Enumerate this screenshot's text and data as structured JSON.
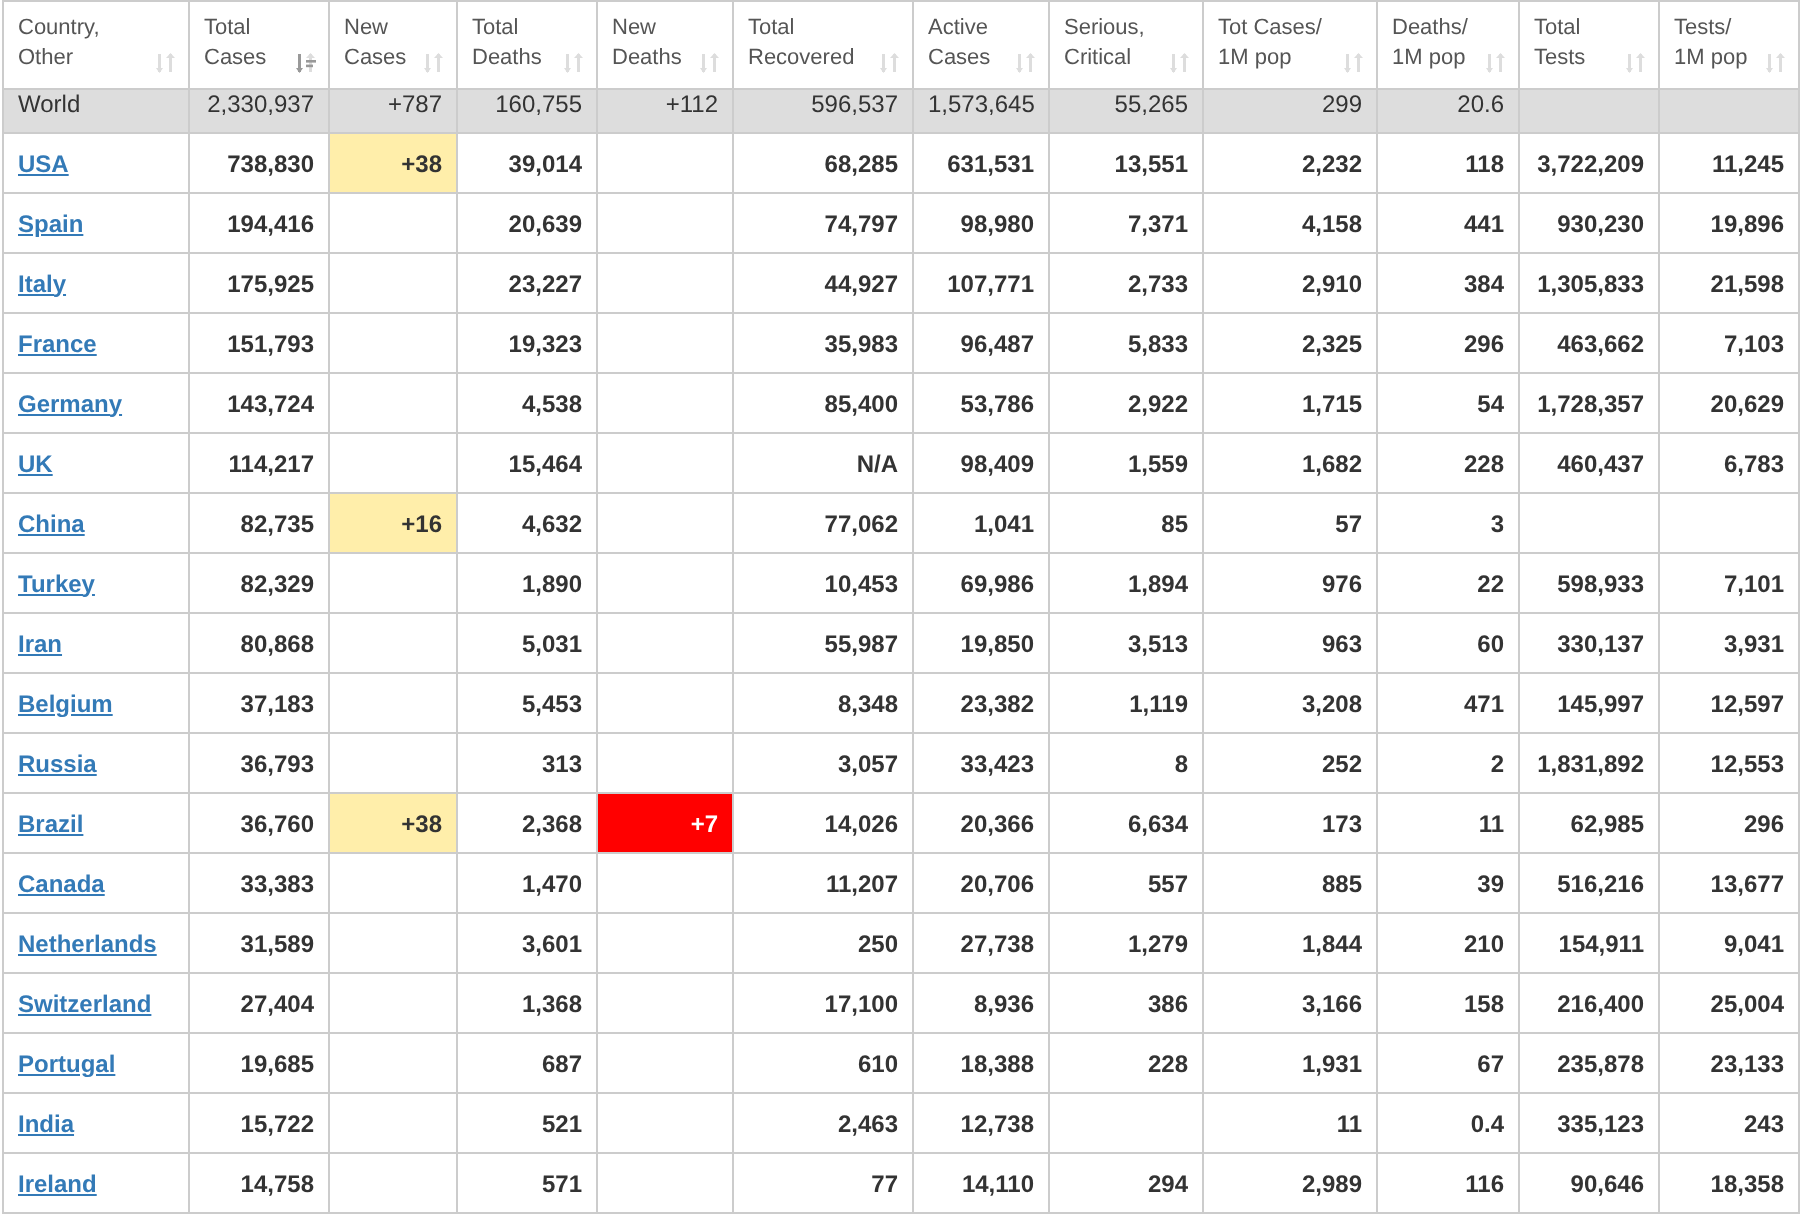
{
  "columns": [
    {
      "label": "Country, Other",
      "sorted": false
    },
    {
      "label": "Total Cases",
      "sorted": true
    },
    {
      "label": "New Cases",
      "sorted": false
    },
    {
      "label": "Total Deaths",
      "sorted": false
    },
    {
      "label": "New Deaths",
      "sorted": false
    },
    {
      "label": "Total Recovered",
      "sorted": false
    },
    {
      "label": "Active Cases",
      "sorted": false
    },
    {
      "label": "Serious, Critical",
      "sorted": false
    },
    {
      "label": "Tot Cases/ 1M pop",
      "sorted": false
    },
    {
      "label": "Deaths/ 1M pop",
      "sorted": false
    },
    {
      "label": "Total Tests",
      "sorted": false
    },
    {
      "label": "Tests/ 1M pop",
      "sorted": false
    }
  ],
  "world": {
    "country": "World",
    "total_cases": "2,330,937",
    "new_cases": "+787",
    "total_deaths": "160,755",
    "new_deaths": "+112",
    "total_recovered": "596,537",
    "active_cases": "1,573,645",
    "serious_critical": "55,265",
    "cases_per_1m": "299",
    "deaths_per_1m": "20.6"
  },
  "rows": [
    {
      "country": "USA",
      "total_cases": "738,830",
      "new_cases": "+38",
      "total_deaths": "39,014",
      "total_recovered": "68,285",
      "active_cases": "631,531",
      "serious_critical": "13,551",
      "cases_per_1m": "2,232",
      "deaths_per_1m": "118",
      "total_tests": "3,722,209",
      "tests_per_1m": "11,245"
    },
    {
      "country": "Spain",
      "total_cases": "194,416",
      "total_deaths": "20,639",
      "total_recovered": "74,797",
      "active_cases": "98,980",
      "serious_critical": "7,371",
      "cases_per_1m": "4,158",
      "deaths_per_1m": "441",
      "total_tests": "930,230",
      "tests_per_1m": "19,896"
    },
    {
      "country": "Italy",
      "total_cases": "175,925",
      "total_deaths": "23,227",
      "total_recovered": "44,927",
      "active_cases": "107,771",
      "serious_critical": "2,733",
      "cases_per_1m": "2,910",
      "deaths_per_1m": "384",
      "total_tests": "1,305,833",
      "tests_per_1m": "21,598"
    },
    {
      "country": "France",
      "total_cases": "151,793",
      "total_deaths": "19,323",
      "total_recovered": "35,983",
      "active_cases": "96,487",
      "serious_critical": "5,833",
      "cases_per_1m": "2,325",
      "deaths_per_1m": "296",
      "total_tests": "463,662",
      "tests_per_1m": "7,103"
    },
    {
      "country": "Germany",
      "total_cases": "143,724",
      "total_deaths": "4,538",
      "total_recovered": "85,400",
      "active_cases": "53,786",
      "serious_critical": "2,922",
      "cases_per_1m": "1,715",
      "deaths_per_1m": "54",
      "total_tests": "1,728,357",
      "tests_per_1m": "20,629"
    },
    {
      "country": "UK",
      "total_cases": "114,217",
      "total_deaths": "15,464",
      "total_recovered": "N/A",
      "active_cases": "98,409",
      "serious_critical": "1,559",
      "cases_per_1m": "1,682",
      "deaths_per_1m": "228",
      "total_tests": "460,437",
      "tests_per_1m": "6,783"
    },
    {
      "country": "China",
      "total_cases": "82,735",
      "new_cases": "+16",
      "total_deaths": "4,632",
      "total_recovered": "77,062",
      "active_cases": "1,041",
      "serious_critical": "85",
      "cases_per_1m": "57",
      "deaths_per_1m": "3"
    },
    {
      "country": "Turkey",
      "total_cases": "82,329",
      "total_deaths": "1,890",
      "total_recovered": "10,453",
      "active_cases": "69,986",
      "serious_critical": "1,894",
      "cases_per_1m": "976",
      "deaths_per_1m": "22",
      "total_tests": "598,933",
      "tests_per_1m": "7,101"
    },
    {
      "country": "Iran",
      "total_cases": "80,868",
      "total_deaths": "5,031",
      "total_recovered": "55,987",
      "active_cases": "19,850",
      "serious_critical": "3,513",
      "cases_per_1m": "963",
      "deaths_per_1m": "60",
      "total_tests": "330,137",
      "tests_per_1m": "3,931"
    },
    {
      "country": "Belgium",
      "total_cases": "37,183",
      "total_deaths": "5,453",
      "total_recovered": "8,348",
      "active_cases": "23,382",
      "serious_critical": "1,119",
      "cases_per_1m": "3,208",
      "deaths_per_1m": "471",
      "total_tests": "145,997",
      "tests_per_1m": "12,597"
    },
    {
      "country": "Russia",
      "total_cases": "36,793",
      "total_deaths": "313",
      "total_recovered": "3,057",
      "active_cases": "33,423",
      "serious_critical": "8",
      "cases_per_1m": "252",
      "deaths_per_1m": "2",
      "total_tests": "1,831,892",
      "tests_per_1m": "12,553"
    },
    {
      "country": "Brazil",
      "total_cases": "36,760",
      "new_cases": "+38",
      "total_deaths": "2,368",
      "new_deaths": "+7",
      "total_recovered": "14,026",
      "active_cases": "20,366",
      "serious_critical": "6,634",
      "cases_per_1m": "173",
      "deaths_per_1m": "11",
      "total_tests": "62,985",
      "tests_per_1m": "296"
    },
    {
      "country": "Canada",
      "total_cases": "33,383",
      "total_deaths": "1,470",
      "total_recovered": "11,207",
      "active_cases": "20,706",
      "serious_critical": "557",
      "cases_per_1m": "885",
      "deaths_per_1m": "39",
      "total_tests": "516,216",
      "tests_per_1m": "13,677"
    },
    {
      "country": "Netherlands",
      "total_cases": "31,589",
      "total_deaths": "3,601",
      "total_recovered": "250",
      "active_cases": "27,738",
      "serious_critical": "1,279",
      "cases_per_1m": "1,844",
      "deaths_per_1m": "210",
      "total_tests": "154,911",
      "tests_per_1m": "9,041"
    },
    {
      "country": "Switzerland",
      "total_cases": "27,404",
      "total_deaths": "1,368",
      "total_recovered": "17,100",
      "active_cases": "8,936",
      "serious_critical": "386",
      "cases_per_1m": "3,166",
      "deaths_per_1m": "158",
      "total_tests": "216,400",
      "tests_per_1m": "25,004"
    },
    {
      "country": "Portugal",
      "total_cases": "19,685",
      "total_deaths": "687",
      "total_recovered": "610",
      "active_cases": "18,388",
      "serious_critical": "228",
      "cases_per_1m": "1,931",
      "deaths_per_1m": "67",
      "total_tests": "235,878",
      "tests_per_1m": "23,133"
    },
    {
      "country": "India",
      "total_cases": "15,722",
      "total_deaths": "521",
      "total_recovered": "2,463",
      "active_cases": "12,738",
      "cases_per_1m": "11",
      "deaths_per_1m": "0.4",
      "total_tests": "335,123",
      "tests_per_1m": "243"
    },
    {
      "country": "Ireland",
      "total_cases": "14,758",
      "total_deaths": "571",
      "total_recovered": "77",
      "active_cases": "14,110",
      "serious_critical": "294",
      "cases_per_1m": "2,989",
      "deaths_per_1m": "116",
      "total_tests": "90,646",
      "tests_per_1m": "18,358"
    }
  ]
}
